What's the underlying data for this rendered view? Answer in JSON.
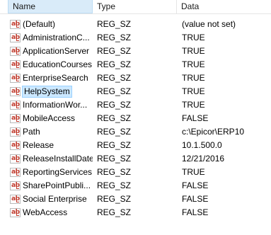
{
  "columns": {
    "name": "Name",
    "type": "Type",
    "data": "Data"
  },
  "icon": "string-value-ab-icon",
  "colors": {
    "selection_bg": "#cce8ff",
    "selection_border": "#99d1ff",
    "sorted_header_bg": "#d9ebf9"
  },
  "rows": [
    {
      "name": "(Default)",
      "type": "REG_SZ",
      "data": "(value not set)"
    },
    {
      "name": "AdministrationC...",
      "type": "REG_SZ",
      "data": "TRUE"
    },
    {
      "name": "ApplicationServer",
      "type": "REG_SZ",
      "data": "TRUE"
    },
    {
      "name": "EducationCourses",
      "type": "REG_SZ",
      "data": "TRUE"
    },
    {
      "name": "EnterpriseSearch",
      "type": "REG_SZ",
      "data": "TRUE"
    },
    {
      "name": "HelpSystem",
      "type": "REG_SZ",
      "data": "TRUE",
      "selected": true
    },
    {
      "name": "InformationWor...",
      "type": "REG_SZ",
      "data": "TRUE"
    },
    {
      "name": "MobileAccess",
      "type": "REG_SZ",
      "data": "FALSE"
    },
    {
      "name": "Path",
      "type": "REG_SZ",
      "data": "c:\\Epicor\\ERP10"
    },
    {
      "name": "Release",
      "type": "REG_SZ",
      "data": "10.1.500.0"
    },
    {
      "name": "ReleaseInstallDate",
      "type": "REG_SZ",
      "data": "12/21/2016"
    },
    {
      "name": "ReportingServices",
      "type": "REG_SZ",
      "data": "TRUE"
    },
    {
      "name": "SharePointPubli...",
      "type": "REG_SZ",
      "data": "FALSE"
    },
    {
      "name": "Social Enterprise",
      "type": "REG_SZ",
      "data": "FALSE"
    },
    {
      "name": "WebAccess",
      "type": "REG_SZ",
      "data": "FALSE"
    }
  ]
}
